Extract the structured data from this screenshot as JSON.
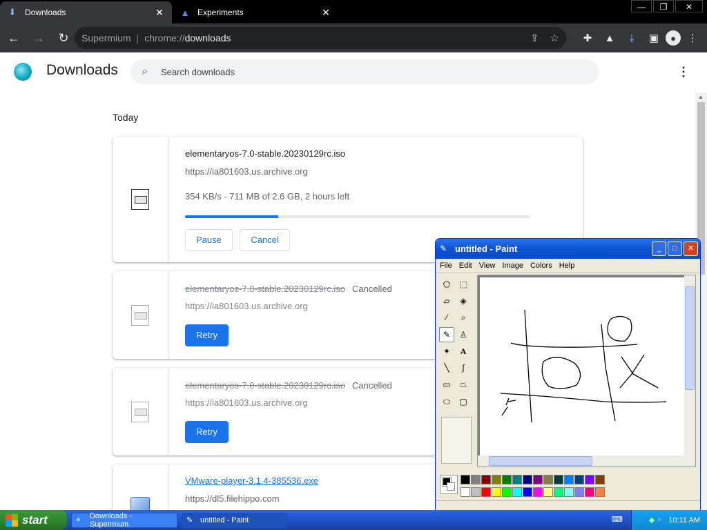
{
  "tabs": [
    {
      "title": "Downloads",
      "icon": "download-icon",
      "close": "✕"
    },
    {
      "title": "Experiments",
      "icon": "flask-icon",
      "close": "✕"
    }
  ],
  "window_controls": {
    "minimize": "—",
    "restore": "❐",
    "close": "✕"
  },
  "omnibox": {
    "browser": "Supermium",
    "separator": "|",
    "scheme": "chrome://",
    "path": "downloads"
  },
  "page": {
    "title": "Downloads",
    "search_placeholder": "Search downloads",
    "section": "Today"
  },
  "downloads": [
    {
      "name": "elementaryos-7.0-stable.20230129rc.iso",
      "source": "https://ia801603.us.archive.org",
      "progress_text": "354 KB/s - 711 MB of 2.6 GB, 2 hours left",
      "progress_fraction": 0.27,
      "buttons": [
        "Pause",
        "Cancel"
      ]
    },
    {
      "name": "elementaryos-7.0-stable.20230129rc.iso",
      "status": "Cancelled",
      "source": "https://ia801603.us.archive.org",
      "button": "Retry"
    },
    {
      "name": "elementaryos-7.0-stable.20230129rc.iso",
      "status": "Cancelled",
      "source": "https://ia801603.us.archive.org",
      "button": "Retry"
    },
    {
      "name": "VMware-player-3.1.4-385536.exe",
      "source": "https://dl5.filehippo.com"
    }
  ],
  "paint": {
    "title": "untitled - Paint",
    "menu": [
      "File",
      "Edit",
      "View",
      "Image",
      "Colors",
      "Help"
    ],
    "palette": [
      "#000000",
      "#808080",
      "#800000",
      "#808000",
      "#008000",
      "#008080",
      "#000080",
      "#800080",
      "#808040",
      "#004040",
      "#0080ff",
      "#004080",
      "#8000ff",
      "#804000",
      "#ffffff",
      "#c0c0c0",
      "#ff0000",
      "#ffff00",
      "#00ff00",
      "#00ffff",
      "#0000ff",
      "#ff00ff",
      "#ffff80",
      "#00ff80",
      "#80ffff",
      "#8080ff",
      "#ff0080",
      "#ff8040"
    ]
  },
  "taskbar": {
    "start": "start",
    "items": [
      {
        "label": "Downloads - Supermium",
        "icon": "chrome-icon"
      },
      {
        "label": "untitled - Paint",
        "icon": "paint-icon"
      }
    ],
    "time": "10:11 AM"
  },
  "colors": {
    "accent": "#1a73e8",
    "tab_bar": "#000000",
    "toolbar": "#35363a",
    "xp_blue": "#245edb"
  }
}
